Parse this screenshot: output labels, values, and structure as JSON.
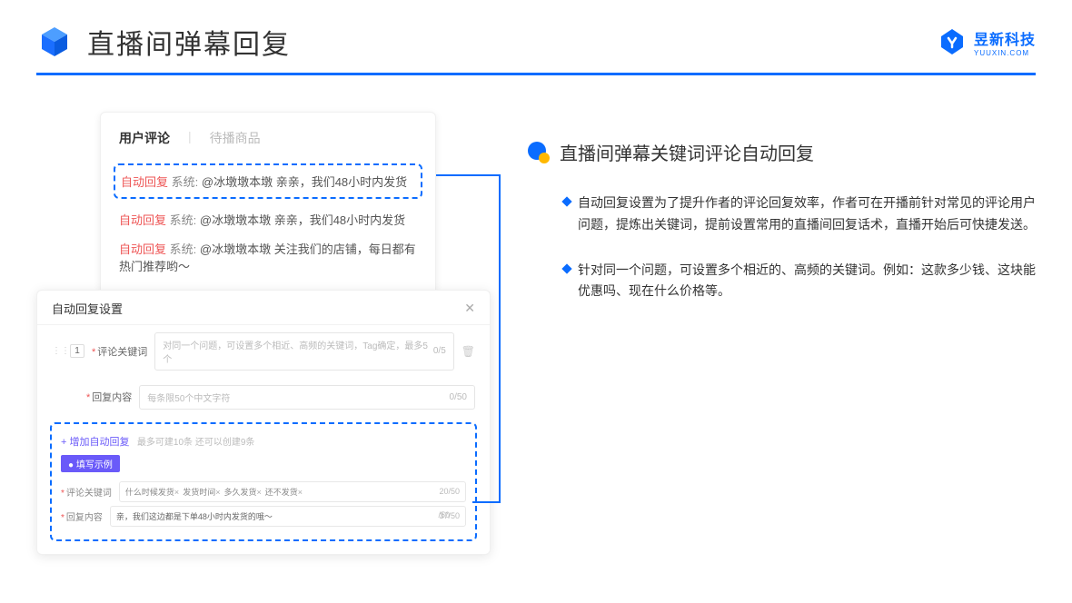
{
  "header": {
    "title": "直播间弹幕回复",
    "brand_name": "昱新科技",
    "brand_url": "YUUXIN.COM"
  },
  "upper_card": {
    "tab_active": "用户评论",
    "tab_inactive": "待播商品",
    "highlight_tag": "自动回复",
    "highlight_sys": "系统:",
    "highlight_text": "@冰墩墩本墩 亲亲，我们48小时内发货",
    "line2_tag": "自动回复",
    "line2_sys": "系统:",
    "line2_text": "@冰墩墩本墩 亲亲，我们48小时内发货",
    "line3_tag": "自动回复",
    "line3_sys": "系统:",
    "line3_text": "@冰墩墩本墩 关注我们的店铺，每日都有热门推荐哟～"
  },
  "lower_card": {
    "title": "自动回复设置",
    "row_num": "1",
    "label_keyword": "评论关键词",
    "placeholder_keyword": "对同一个问题，可设置多个相近、高频的关键词，Tag确定，最多5个",
    "count_keyword": "0/5",
    "label_content": "回复内容",
    "placeholder_content": "每条限50个中文字符",
    "count_content": "0/50",
    "add_link": "+ 增加自动回复",
    "add_hint": "最多可建10条 还可以创建9条",
    "example_badge": "● 填写示例",
    "ex_label_kw": "评论关键词",
    "ex_tag1": "什么时候发货",
    "ex_tag2": "发货时间",
    "ex_tag3": "多久发货",
    "ex_tag4": "还不发货",
    "ex_count_kw": "20/50",
    "ex_label_content": "回复内容",
    "ex_content_text": "亲，我们这边都是下单48小时内发货的哦～",
    "ex_count_content": "37/50",
    "outer_count": "/50"
  },
  "right": {
    "title": "直播间弹幕关键词评论自动回复",
    "bullet1": "自动回复设置为了提升作者的评论回复效率，作者可在开播前针对常见的评论用户问题，提炼出关键词，提前设置常用的直播间回复话术，直播开始后可快捷发送。",
    "bullet2": "针对同一个问题，可设置多个相近的、高频的关键词。例如：这款多少钱、这块能优惠吗、现在什么价格等。"
  }
}
